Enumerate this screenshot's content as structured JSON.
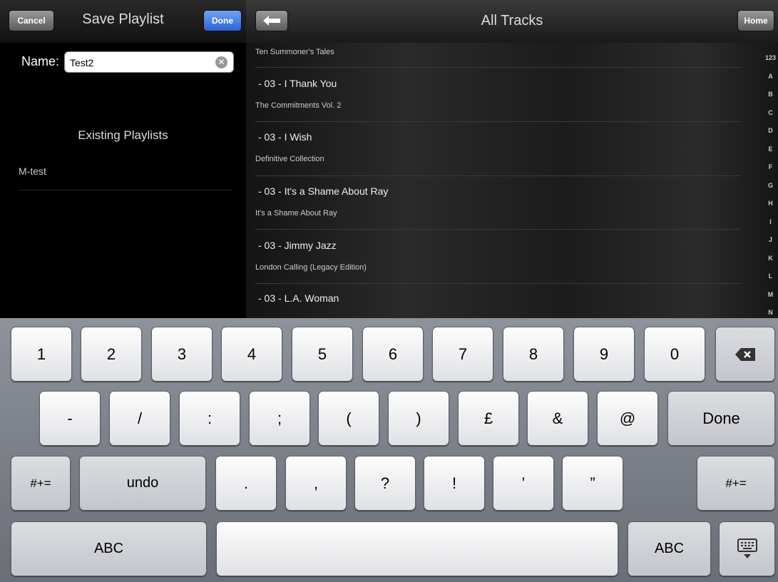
{
  "left_panel": {
    "cancel_label": "Cancel",
    "title": "Save Playlist",
    "done_label": "Done",
    "name_label": "Name:",
    "name_value": "Test2",
    "existing_title": "Existing Playlists",
    "playlists": [
      "M-test"
    ]
  },
  "right_panel": {
    "title": "All Tracks",
    "home_label": "Home",
    "first_album": "Ten Summoner's Tales",
    "tracks": [
      {
        "title": "- 03 - I Thank You",
        "album": "The Commitments Vol. 2"
      },
      {
        "title": "- 03 - I Wish",
        "album": "Definitive Collection"
      },
      {
        "title": "- 03 - It's a Shame About Ray",
        "album": "It's a Shame About Ray"
      },
      {
        "title": "- 03 - Jimmy Jazz",
        "album": "London Calling (Legacy Edition)"
      },
      {
        "title": "- 03 - L.A. Woman",
        "album": ""
      }
    ],
    "index": [
      "123",
      "A",
      "B",
      "C",
      "D",
      "E",
      "F",
      "G",
      "H",
      "I",
      "J",
      "K",
      "L",
      "M",
      "N"
    ]
  },
  "keyboard": {
    "row1": [
      "1",
      "2",
      "3",
      "4",
      "5",
      "6",
      "7",
      "8",
      "9",
      "0"
    ],
    "row2": [
      "-",
      "/",
      ":",
      ";",
      "(",
      ")",
      "£",
      "&",
      "@"
    ],
    "return_label": "Done",
    "row3_left": "#+=",
    "undo": "undo",
    "row3": [
      ".",
      ",",
      "?",
      "!",
      "’",
      "”"
    ],
    "row3_right": "#+=",
    "abc_left": "ABC",
    "abc_right": "ABC"
  }
}
